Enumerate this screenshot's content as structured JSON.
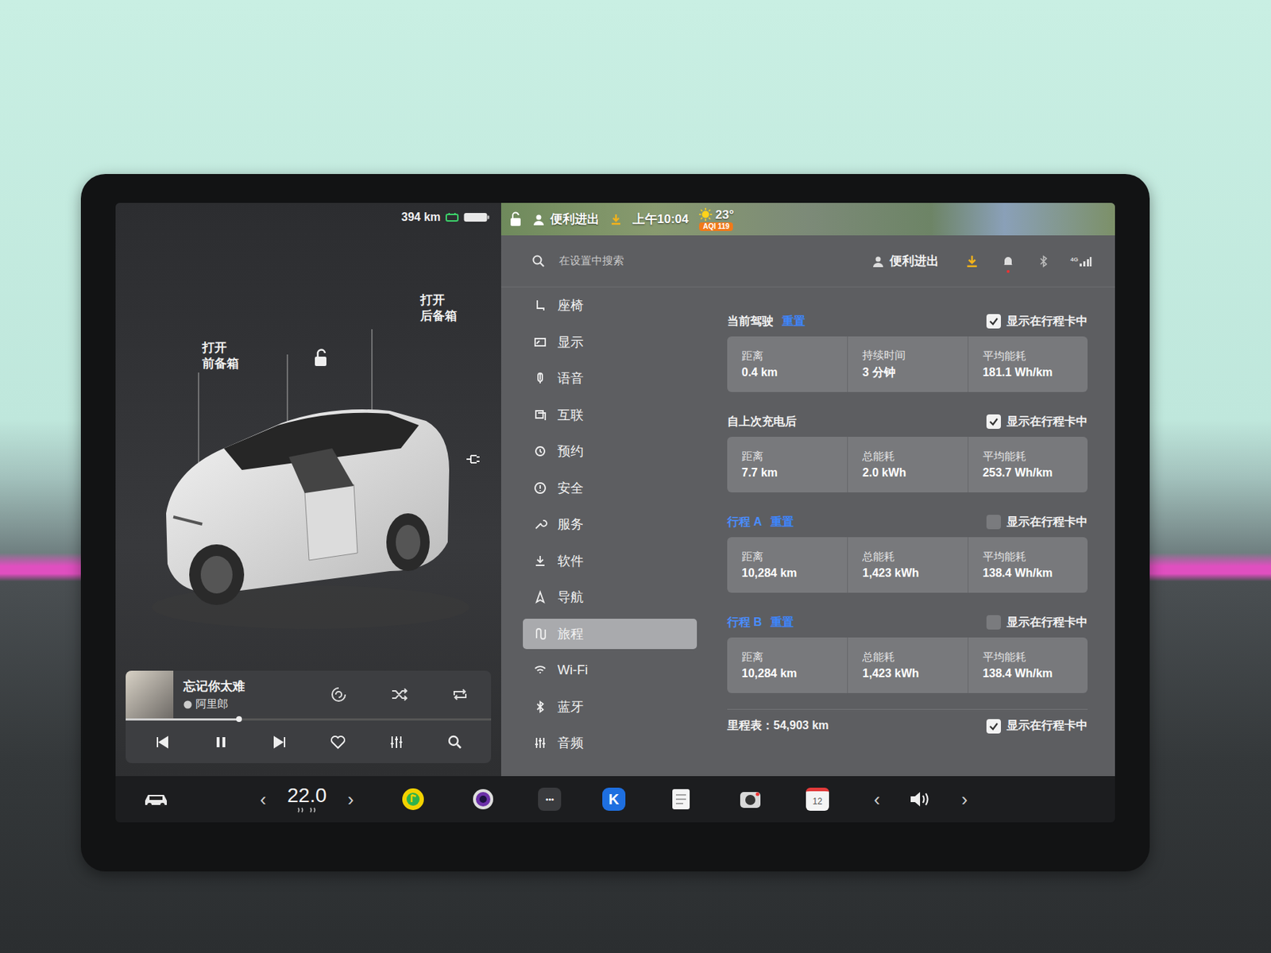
{
  "left_panel": {
    "range": "394 km",
    "frunk_label": [
      "打开",
      "前备箱"
    ],
    "trunk_label": [
      "打开",
      "后备箱"
    ]
  },
  "music": {
    "title": "忘记你太难",
    "artist": "阿里郎",
    "progress": 0.31,
    "playing": true
  },
  "top_strip": {
    "profile": "便利进出",
    "time": "上午10:04",
    "temperature": "23°",
    "aqi": "AQI 119"
  },
  "search": {
    "placeholder": "在设置中搜索",
    "profile": "便利进出",
    "signal_label": "4G"
  },
  "menu": [
    {
      "label": "座椅",
      "selected": false
    },
    {
      "label": "显示",
      "selected": false
    },
    {
      "label": "语音",
      "selected": false
    },
    {
      "label": "互联",
      "selected": false
    },
    {
      "label": "预约",
      "selected": false
    },
    {
      "label": "安全",
      "selected": false
    },
    {
      "label": "服务",
      "selected": false
    },
    {
      "label": "软件",
      "selected": false
    },
    {
      "label": "导航",
      "selected": false
    },
    {
      "label": "旅程",
      "selected": true
    },
    {
      "label": "Wi-Fi",
      "selected": false
    },
    {
      "label": "蓝牙",
      "selected": false
    },
    {
      "label": "音频",
      "selected": false
    }
  ],
  "trips": [
    {
      "title": "当前驾驶",
      "kind": "fixed",
      "reset": "重置",
      "show_label": "显示在行程卡中",
      "checked": true,
      "stats": [
        {
          "label": "距离",
          "value": "0.4 km"
        },
        {
          "label": "持续时间",
          "value": "3 分钟"
        },
        {
          "label": "平均能耗",
          "value": "181.1 Wh/km"
        }
      ]
    },
    {
      "title": "自上次充电后",
      "kind": "fixed",
      "reset": "",
      "show_label": "显示在行程卡中",
      "checked": true,
      "stats": [
        {
          "label": "距离",
          "value": "7.7 km"
        },
        {
          "label": "总能耗",
          "value": "2.0 kWh"
        },
        {
          "label": "平均能耗",
          "value": "253.7 Wh/km"
        }
      ]
    },
    {
      "title": "行程 A",
      "kind": "custom",
      "reset": "重置",
      "show_label": "显示在行程卡中",
      "checked": false,
      "stats": [
        {
          "label": "距离",
          "value": "10,284 km"
        },
        {
          "label": "总能耗",
          "value": "1,423 kWh"
        },
        {
          "label": "平均能耗",
          "value": "138.4 Wh/km"
        }
      ]
    },
    {
      "title": "行程 B",
      "kind": "custom",
      "reset": "重置",
      "show_label": "显示在行程卡中",
      "checked": false,
      "stats": [
        {
          "label": "距离",
          "value": "10,284 km"
        },
        {
          "label": "总能耗",
          "value": "1,423 kWh"
        },
        {
          "label": "平均能耗",
          "value": "138.4 Wh/km"
        }
      ]
    }
  ],
  "odometer": {
    "label": "里程表：54,903 km",
    "show_label": "显示在行程卡中",
    "checked": true
  },
  "bottom_bar": {
    "temperature": "22.0",
    "left_arrow": "‹",
    "right_arrow": "›",
    "apps": [
      {
        "kind": "music",
        "text": ""
      },
      {
        "kind": "camera",
        "text": ""
      },
      {
        "kind": "more",
        "text": "•••"
      },
      {
        "kind": "k",
        "text": "K"
      },
      {
        "kind": "notes",
        "text": ""
      },
      {
        "kind": "dashcam",
        "text": ""
      },
      {
        "kind": "calendar",
        "text": "12"
      }
    ]
  }
}
